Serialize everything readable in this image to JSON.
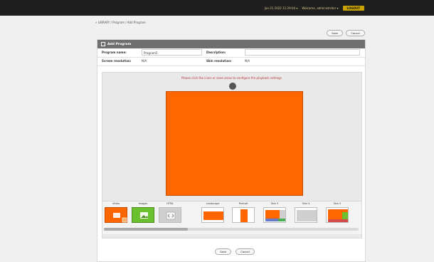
{
  "topbar": {
    "datetime": "Jan 21 2022 11:29:04 ▾",
    "welcome": "Welcome, administrator ▾",
    "logout": "LOGOUT"
  },
  "breadcrumb": "» LIBRARY / Program / Add Program",
  "actions": {
    "save_label": "Save",
    "cancel_label": "Cancel"
  },
  "panel": {
    "title": "Add Program",
    "fields": {
      "program_name_label": "Program name:",
      "program_name_value": "Program5",
      "description_label": "Description:",
      "description_value": "",
      "screen_resolution_label": "Screen resolution:",
      "screen_resolution_value": "N/A",
      "skin_resolution_label": "Skin resolution:",
      "skin_resolution_value": "N/A"
    },
    "hint": "Please click the icons or zone areas to configure the playback settings.",
    "zones": [
      {
        "label": "Video"
      },
      {
        "label": "Images"
      },
      {
        "label": "HTML"
      },
      {
        "label": "Landscape"
      },
      {
        "label": "Portrait"
      },
      {
        "label": "Skin 3"
      },
      {
        "label": "Skin 4"
      },
      {
        "label": "Skin 5"
      }
    ]
  },
  "colors": {
    "accent_orange": "#ff6600",
    "images_green": "#6ac12d",
    "header_gray": "#6f6f6f",
    "topbar_dark": "#1f1f1f",
    "logout_yellow": "#c9a400"
  }
}
